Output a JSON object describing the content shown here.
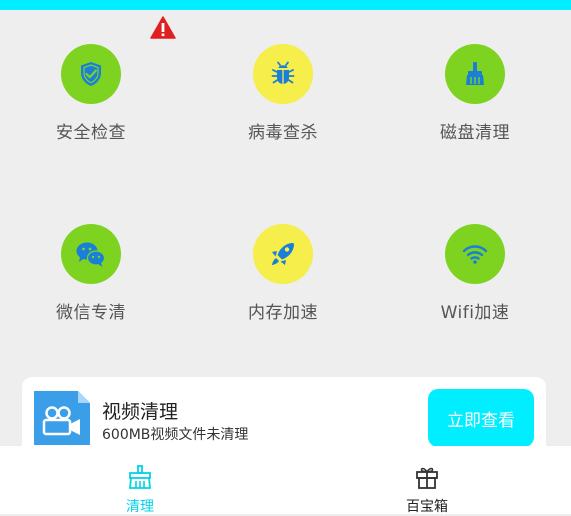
{
  "colors": {
    "accent": "#00eeff",
    "icon_blue": "#1a7fd8",
    "green_circle": "#7ed321",
    "yellow_circle": "#f6ee4a",
    "warning": "#e02020"
  },
  "grid": [
    {
      "label": "安全检查",
      "icon": "shield-icon"
    },
    {
      "label": "病毒查杀",
      "icon": "bug-icon"
    },
    {
      "label": "磁盘清理",
      "icon": "broom-icon"
    },
    {
      "label": "微信专清",
      "icon": "wechat-icon"
    },
    {
      "label": "内存加速",
      "icon": "rocket-icon"
    },
    {
      "label": "Wifi加速",
      "icon": "wifi-icon"
    }
  ],
  "card": {
    "title": "视频清理",
    "subtitle": "600MB视频文件未清理",
    "button": "立即查看",
    "icon": "video-camera-icon"
  },
  "nav": [
    {
      "label": "清理",
      "icon": "clean-icon",
      "active": true
    },
    {
      "label": "百宝箱",
      "icon": "gift-icon",
      "active": false
    }
  ]
}
